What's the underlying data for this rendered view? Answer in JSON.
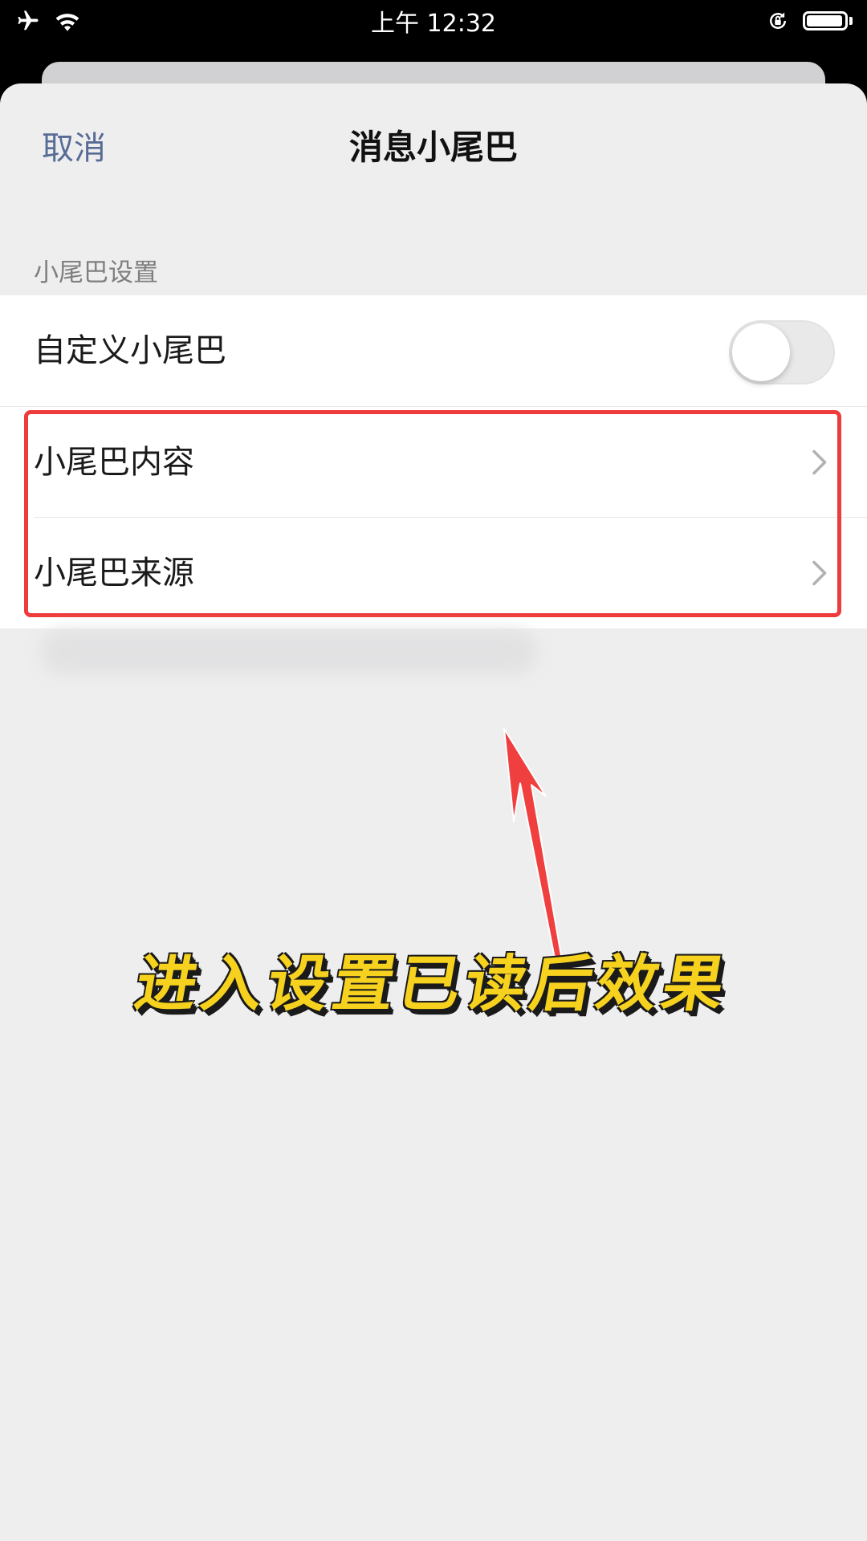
{
  "status_bar": {
    "time": "上午 12:32",
    "left_icons": [
      "airplane-icon",
      "wifi-icon"
    ],
    "right_icons": [
      "rotation-lock-icon",
      "battery-icon"
    ],
    "battery_level": 0.95
  },
  "nav": {
    "cancel_label": "取消",
    "title": "消息小尾巴"
  },
  "section": {
    "header": "小尾巴设置",
    "rows": [
      {
        "label": "自定义小尾巴",
        "control": "toggle",
        "on": false
      },
      {
        "label": "小尾巴内容",
        "control": "chevron"
      },
      {
        "label": "小尾巴来源",
        "control": "chevron"
      }
    ]
  },
  "annotation": {
    "caption": "进入设置已读后效果",
    "highlight_color": "#ee3b3b",
    "caption_color": "#f6d21f"
  },
  "colors": {
    "link_blue": "#576b95",
    "background": "#eeeeef"
  }
}
